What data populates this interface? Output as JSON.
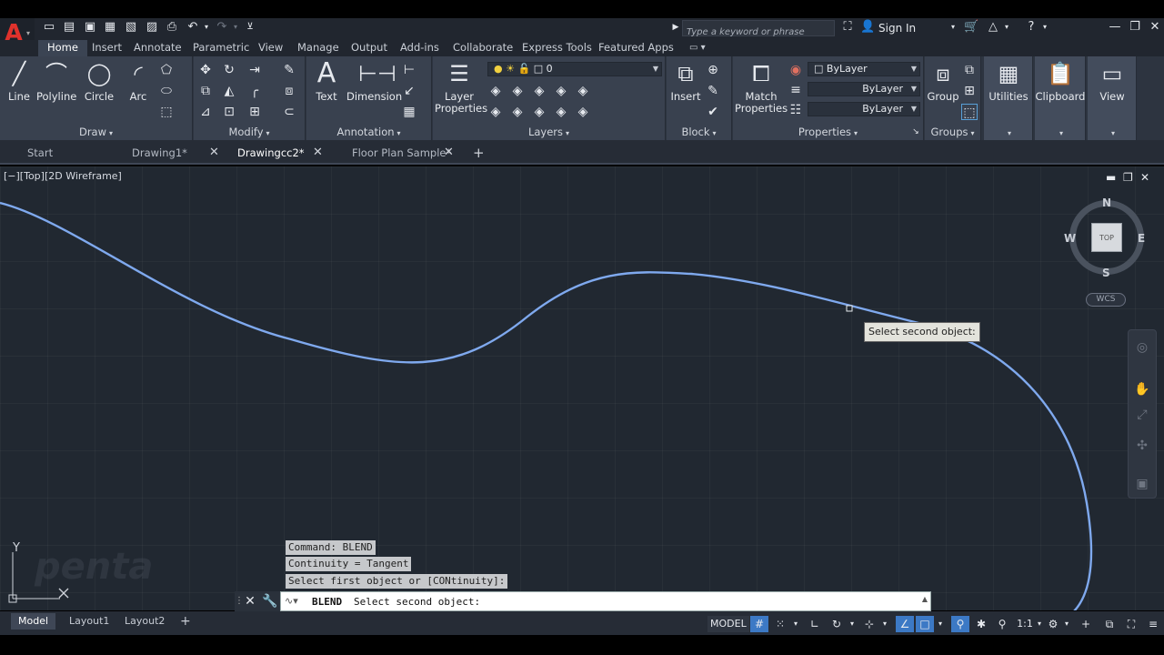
{
  "app": {
    "logo": "A"
  },
  "search": {
    "placeholder": "Type a keyword or phrase"
  },
  "account": {
    "sign_in": "Sign In"
  },
  "ribbon_tabs": [
    "Home",
    "Insert",
    "Annotate",
    "Parametric",
    "View",
    "Manage",
    "Output",
    "Add-ins",
    "Collaborate",
    "Express Tools",
    "Featured Apps"
  ],
  "draw": {
    "title": "Draw",
    "line": "Line",
    "polyline": "Polyline",
    "circle": "Circle",
    "arc": "Arc"
  },
  "modify": {
    "title": "Modify"
  },
  "annotation": {
    "title": "Annotation",
    "text": "Text",
    "dimension": "Dimension"
  },
  "layers": {
    "title": "Layers",
    "layer_properties": "Layer Properties",
    "current_layer": "0"
  },
  "block": {
    "title": "Block",
    "insert": "Insert"
  },
  "properties": {
    "title": "Properties",
    "match": "Match Properties",
    "color": "ByLayer",
    "linetype": "ByLayer",
    "lineweight": "ByLayer"
  },
  "groups": {
    "title": "Groups",
    "group": "Group"
  },
  "utilities": "Utilities",
  "clipboard": "Clipboard",
  "view_panel": "View",
  "doc_tabs": [
    "Start",
    "Drawing1*",
    "Drawingcc2*",
    "Floor Plan Sample*"
  ],
  "viewport": {
    "label": "[−][Top][2D Wireframe]"
  },
  "viewcube": {
    "n": "N",
    "s": "S",
    "e": "E",
    "w": "W",
    "top": "TOP",
    "wcs": "WCS"
  },
  "tooltip": "Select second object:",
  "ucs": {
    "y": "Y"
  },
  "watermark": "penta",
  "command": {
    "history": [
      "Command: BLEND",
      "Continuity = Tangent",
      "Select first object or [CONtinuity]:"
    ],
    "name": "BLEND",
    "value": "Select second object:"
  },
  "layouts": [
    "Model",
    "Layout1",
    "Layout2"
  ],
  "status": {
    "model": "MODEL",
    "scale": "1:1"
  }
}
